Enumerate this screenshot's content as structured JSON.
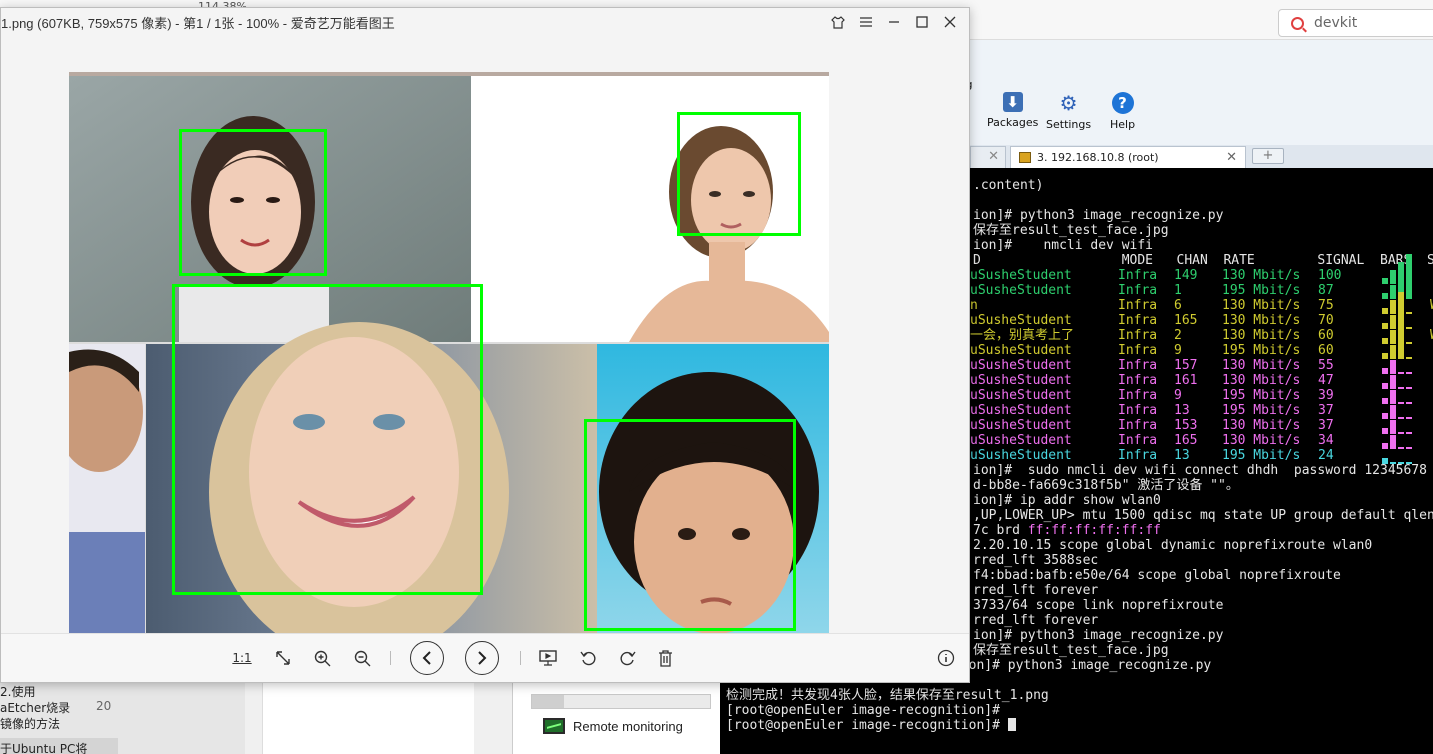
{
  "browser": {
    "search_text": "devkit",
    "zoom_peek": "114.38%"
  },
  "viewer": {
    "title": "1.png (607KB, 759x575 像素) - 第1 / 1张 - 100% - 爱奇艺万能看图王",
    "toolbar": {
      "actual_size_label": "1:1"
    }
  },
  "moba": {
    "toolbar_partial_label": "g",
    "packages_label": "Packages",
    "settings_label": "Settings",
    "help_label": "Help",
    "session_tab_label": "3. 192.168.10.8 (root)",
    "side_panel_item": "Remote monitoring"
  },
  "left_panel": {
    "line1": "2.使用",
    "line2": "aEtcher烧录",
    "line3": "镜像的方法",
    "count": "20",
    "line4": "于Ubuntu PC将"
  },
  "terminal": {
    "lines_top": [
      ".content)",
      "",
      "ion]# python3 image_recognize.py",
      "保存至result_test_face.jpg",
      "ion]#    nmcli dev wifi"
    ],
    "wifi_header": "D                  MODE   CHAN  RATE        SIGNAL  BARS  S",
    "wifi_rows": [
      {
        "ssid": "uSusheStudent",
        "mode": "Infra",
        "chan": "149",
        "rate": "130 Mbit/s",
        "signal": "100",
        "color": "green",
        "tail": ""
      },
      {
        "ssid": "uSusheStudent",
        "mode": "Infra",
        "chan": "1",
        "rate": "195 Mbit/s",
        "signal": "87",
        "color": "green",
        "tail": ""
      },
      {
        "ssid": "n",
        "mode": "Infra",
        "chan": "6",
        "rate": "130 Mbit/s",
        "signal": "75",
        "color": "yellow",
        "tail": "W"
      },
      {
        "ssid": "uSusheStudent",
        "mode": "Infra",
        "chan": "165",
        "rate": "130 Mbit/s",
        "signal": "70",
        "color": "yellow",
        "tail": ""
      },
      {
        "ssid": "一会，别真考上了",
        "mode": "Infra",
        "chan": "2",
        "rate": "130 Mbit/s",
        "signal": "60",
        "color": "yellow",
        "tail": "W"
      },
      {
        "ssid": "uSusheStudent",
        "mode": "Infra",
        "chan": "9",
        "rate": "195 Mbit/s",
        "signal": "60",
        "color": "yellow",
        "tail": ""
      },
      {
        "ssid": "uSusheStudent",
        "mode": "Infra",
        "chan": "157",
        "rate": "130 Mbit/s",
        "signal": "55",
        "color": "mag",
        "tail": ""
      },
      {
        "ssid": "uSusheStudent",
        "mode": "Infra",
        "chan": "161",
        "rate": "130 Mbit/s",
        "signal": "47",
        "color": "mag",
        "tail": ""
      },
      {
        "ssid": "uSusheStudent",
        "mode": "Infra",
        "chan": "9",
        "rate": "195 Mbit/s",
        "signal": "39",
        "color": "mag",
        "tail": ""
      },
      {
        "ssid": "uSusheStudent",
        "mode": "Infra",
        "chan": "13",
        "rate": "195 Mbit/s",
        "signal": "37",
        "color": "mag",
        "tail": ""
      },
      {
        "ssid": "uSusheStudent",
        "mode": "Infra",
        "chan": "153",
        "rate": "130 Mbit/s",
        "signal": "37",
        "color": "mag",
        "tail": ""
      },
      {
        "ssid": "uSusheStudent",
        "mode": "Infra",
        "chan": "165",
        "rate": "130 Mbit/s",
        "signal": "34",
        "color": "mag",
        "tail": ""
      },
      {
        "ssid": "uSusheStudent",
        "mode": "Infra",
        "chan": "13",
        "rate": "195 Mbit/s",
        "signal": "24",
        "color": "cyan",
        "tail": ""
      }
    ],
    "lines_bottom": [
      "ion]#  sudo nmcli dev wifi connect dhdh  password 12345678",
      "d-bb8e-fa669c318f5b\" 激活了设备 \"\"。",
      "ion]# ip addr show wlan0",
      ",UP,LOWER_UP> mtu 1500 qdisc mq state UP group default qlen",
      "7c brd ",
      "2.20.10.15 scope global dynamic noprefixroute wlan0",
      "rred_lft 3588sec",
      "f4:bbad:bafb:e50e/64 scope global noprefixroute",
      "rred_lft forever",
      "3733/64 scope link noprefixroute",
      "rred_lft forever",
      "ion]# python3 image_recognize.py",
      "保存至result_test_face.jpg",
      "[root@openEuler image-recognition]# python3 image_recognize.py",
      "",
      "检测完成！共发现4张人脸，结果保存至result_1.png",
      "[root@openEuler image-recognition]#",
      "[root@openEuler image-recognition]# "
    ],
    "brd_value": "ff:ff:ff:ff:ff:ff"
  },
  "colors": {
    "face_box": "#00ff00",
    "terminal_bg": "#000000",
    "green": "#2ecf6e",
    "yellow": "#d0cc30",
    "magenta": "#f070f0",
    "cyan": "#4ad7e0"
  }
}
